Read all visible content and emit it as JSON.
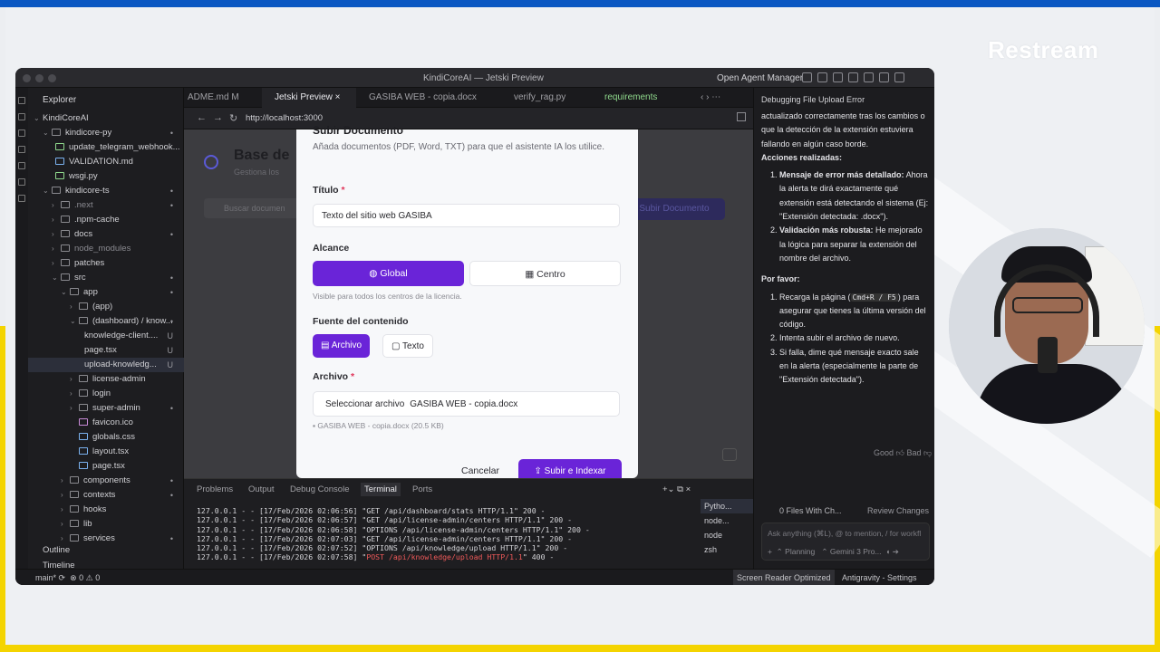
{
  "overlay": {
    "brand": "Restream"
  },
  "window": {
    "title": "KindiCoreAI — Jetski Preview",
    "agent_manager": "Open Agent Manager"
  },
  "explorer": {
    "header": "Explorer",
    "items": [
      {
        "name": "KindiCoreAI",
        "mark": ""
      },
      {
        "name": "kindicore-py",
        "mark": "•"
      },
      {
        "name": "update_telegram_webhook...",
        "mark": ""
      },
      {
        "name": "VALIDATION.md",
        "mark": ""
      },
      {
        "name": "wsgi.py",
        "mark": ""
      },
      {
        "name": "kindicore-ts",
        "mark": "•"
      },
      {
        "name": ".next",
        "mark": "•"
      },
      {
        "name": ".npm-cache",
        "mark": ""
      },
      {
        "name": "docs",
        "mark": "•"
      },
      {
        "name": "node_modules",
        "mark": ""
      },
      {
        "name": "patches",
        "mark": ""
      },
      {
        "name": "src",
        "mark": "•"
      },
      {
        "name": "app",
        "mark": "•"
      },
      {
        "name": "(app)",
        "mark": ""
      },
      {
        "name": "(dashboard) / know...",
        "mark": "•"
      },
      {
        "name": "knowledge-client....",
        "mark": "U"
      },
      {
        "name": "page.tsx",
        "mark": "U"
      },
      {
        "name": "upload-knowledg...",
        "mark": "U"
      },
      {
        "name": "license-admin",
        "mark": ""
      },
      {
        "name": "login",
        "mark": ""
      },
      {
        "name": "super-admin",
        "mark": "•"
      },
      {
        "name": "favicon.ico",
        "mark": ""
      },
      {
        "name": "globals.css",
        "mark": ""
      },
      {
        "name": "layout.tsx",
        "mark": ""
      },
      {
        "name": "page.tsx",
        "mark": ""
      },
      {
        "name": "components",
        "mark": "•"
      },
      {
        "name": "contexts",
        "mark": "•"
      },
      {
        "name": "hooks",
        "mark": ""
      },
      {
        "name": "lib",
        "mark": ""
      },
      {
        "name": "services",
        "mark": "•"
      }
    ],
    "outline": "Outline",
    "timeline": "Timeline"
  },
  "tabs": [
    {
      "label": "ADME.md M"
    },
    {
      "label": "Jetski Preview ×"
    },
    {
      "label": "GASIBA WEB - copia.docx"
    },
    {
      "label": "verify_rag.py"
    },
    {
      "label": "requirements"
    }
  ],
  "browser": {
    "url": "http://localhost:3000"
  },
  "page": {
    "title": "Base de",
    "subtitle": "Gestiona los",
    "search_placeholder": "Buscar documen",
    "upload_btn": "Subir Documento"
  },
  "modal": {
    "title": "Subir Documento",
    "description": "Añada documentos (PDF, Word, TXT) para que el asistente IA los utilice.",
    "title_label": "Título",
    "required": "*",
    "title_value": "Texto del sitio web GASIBA",
    "scope_label": "Alcance",
    "scope_global": "Global",
    "scope_centro": "Centro",
    "scope_hint": "Visible para todos los centros de la licencia.",
    "source_label": "Fuente del contenido",
    "source_file": "Archivo",
    "source_text": "Texto",
    "file_label": "Archivo",
    "file_button": "Seleccionar archivo",
    "file_name": "GASIBA WEB - copia.docx",
    "file_info": "GASIBA WEB - copia.docx (20.5 KB)",
    "cancel": "Cancelar",
    "submit": "Subir e Indexar"
  },
  "panel": {
    "tabs": [
      "Problems",
      "Output",
      "Debug Console",
      "Terminal",
      "Ports"
    ],
    "log": [
      {
        "text": "127.0.0.1 - - [17/Feb/2026 02:06:56] \"GET /api/dashboard/stats HTTP/1.1\" 200 -",
        "err": ""
      },
      {
        "text": "127.0.0.1 - - [17/Feb/2026 02:06:57] \"GET /api/license-admin/centers HTTP/1.1\" 200 -",
        "err": ""
      },
      {
        "text": "127.0.0.1 - - [17/Feb/2026 02:06:58] \"OPTIONS /api/license-admin/centers HTTP/1.1\" 200 -",
        "err": ""
      },
      {
        "text": "127.0.0.1 - - [17/Feb/2026 02:07:03] \"GET /api/license-admin/centers HTTP/1.1\" 200 -",
        "err": ""
      },
      {
        "text": "127.0.0.1 - - [17/Feb/2026 02:07:52] \"OPTIONS /api/knowledge/upload HTTP/1.1\" 200 -",
        "err": ""
      },
      {
        "text": "127.0.0.1 - - [17/Feb/2026 02:07:58] \"",
        "err": "POST /api/knowledge/upload HTTP/1.1",
        "tail": "\" 400 -"
      }
    ],
    "terminals": [
      "Pytho...",
      "node...",
      "node",
      "zsh"
    ]
  },
  "chat": {
    "header": "Debugging File Upload Error",
    "intro": "actualizado correctamente tras los cambios o que la detección de la extensión estuviera fallando en algún caso borde.",
    "actions_title": "Acciones realizadas:",
    "action1_title": "Mensaje de error más detallado:",
    "action1_text": "Ahora la alerta te dirá exactamente qué extensión está detectando el sistema (Ej: \"Extensión detectada: .docx\").",
    "action2_title": "Validación más robusta:",
    "action2_text": "He mejorado la lógica para separar la extensión del nombre del archivo.",
    "please_title": "Por favor:",
    "step1_pre": "Recarga la página (",
    "step1_kbd": "Cmd+R / F5",
    "step1_post": ") para asegurar que tienes la última versión del código.",
    "step2": "Intenta subir el archivo de nuevo.",
    "step3": "Si falla, dime qué mensaje exacto sale en la alerta (especialmente la parte de \"Extensión detectada\").",
    "feedback_good": "Good",
    "feedback_bad": "Bad",
    "files_changed": "0 Files With Ch...",
    "review": "Review Changes",
    "ask_placeholder": "Ask anything (⌘L), @ to mention, / for workfl",
    "mode": "Planning",
    "model": "Gemini 3 Pro..."
  },
  "status": {
    "branch": "main*",
    "problems": "⊗ 0 ⚠ 0",
    "reader": "Screen Reader Optimized",
    "settings": "Antigravity - Settings"
  }
}
